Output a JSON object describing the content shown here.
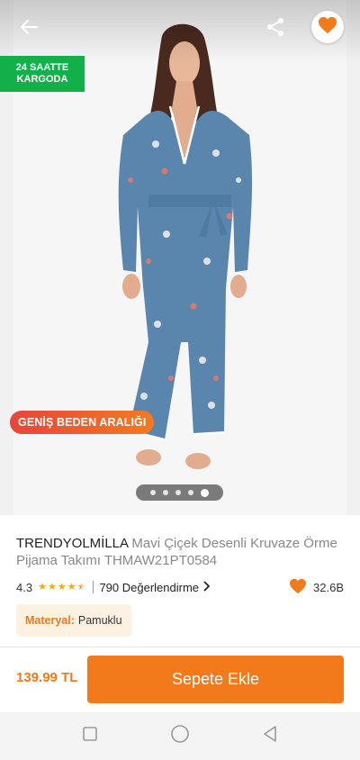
{
  "hero": {
    "cargo_badge": "24 SAATTE KARGODA",
    "size_badge": "GENİŞ BEDEN ARALIĞI",
    "image_count": 5,
    "active_image": 5,
    "icons": {
      "back": "arrow-left-icon",
      "share": "share-icon",
      "favorite": "heart-icon"
    }
  },
  "product": {
    "brand": "TRENDYOLMİLLA",
    "name": "Mavi Çiçek Desenli Kruvaze Örme Pijama Takımı THMAW21PT0584",
    "rating": "4.3",
    "rating_stars": 4.3,
    "reviews_text": "790 Değerlendirme",
    "favorite_count": "32.6B",
    "material_key": "Materyal:",
    "material_value": "Pamuklu"
  },
  "purchase": {
    "price": "139.99 TL",
    "add_to_cart": "Sepete Ekle"
  },
  "colors": {
    "accent": "#f27a1a",
    "cargo_green": "#12b04a",
    "star": "#f5a623",
    "pajama_blue": "#5a86ad"
  },
  "system_nav": {
    "icons": [
      "square-icon",
      "circle-icon",
      "triangle-back-icon"
    ]
  }
}
